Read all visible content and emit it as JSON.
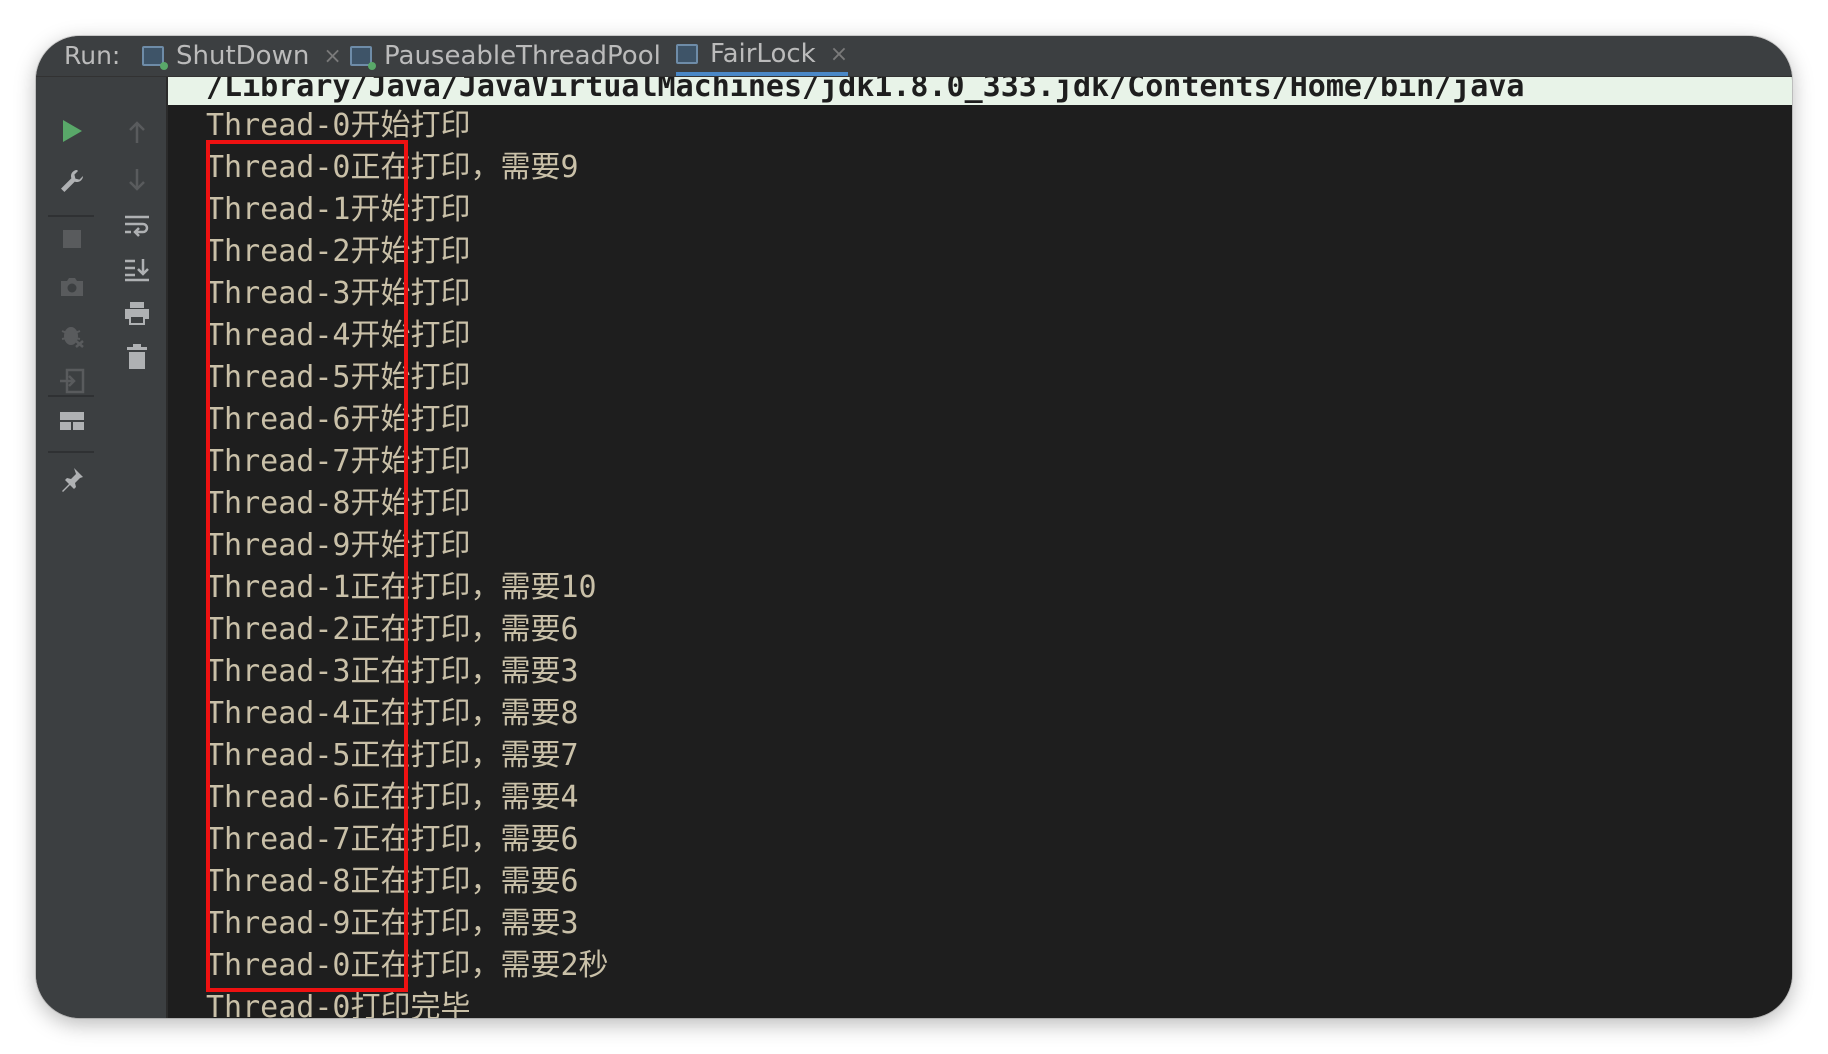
{
  "run_label": "Run:",
  "tabs": [
    {
      "label": "ShutDown",
      "close": "×",
      "active": false
    },
    {
      "label": "PauseableThreadPool",
      "close": "×",
      "active": false
    },
    {
      "label": "FairLock",
      "close": "×",
      "active": true
    }
  ],
  "console": {
    "command": "/Library/Java/JavaVirtualMachines/jdk1.8.0_333.jdk/Contents/Home/bin/java",
    "lines": [
      "Thread-0开始打印",
      "Thread-0正在打印，需要9",
      "Thread-1开始打印",
      "Thread-2开始打印",
      "Thread-3开始打印",
      "Thread-4开始打印",
      "Thread-5开始打印",
      "Thread-6开始打印",
      "Thread-7开始打印",
      "Thread-8开始打印",
      "Thread-9开始打印",
      "Thread-1正在打印，需要10",
      "Thread-2正在打印，需要6",
      "Thread-3正在打印，需要3",
      "Thread-4正在打印，需要8",
      "Thread-5正在打印，需要7",
      "Thread-6正在打印，需要4",
      "Thread-7正在打印，需要6",
      "Thread-8正在打印，需要6",
      "Thread-9正在打印，需要3",
      "Thread-0正在打印，需要2秒",
      "Thread-0打印完毕"
    ]
  },
  "colors": {
    "console_bg": "#1e1e1e",
    "console_text": "#c9c0a8",
    "command_bg": "#e8f3e8",
    "highlight": "#ee1111",
    "run_green": "#59a869"
  },
  "icons": {
    "left_toolbar": [
      "run-icon",
      "wrench-icon",
      "stop-icon",
      "camera-icon",
      "debug-bug-icon",
      "login-icon",
      "layout-icon",
      "pin-icon"
    ],
    "mid_toolbar": [
      "arrow-up-icon",
      "arrow-down-icon",
      "soft-wrap-icon",
      "scroll-to-end-icon",
      "print-icon",
      "trash-icon"
    ]
  }
}
